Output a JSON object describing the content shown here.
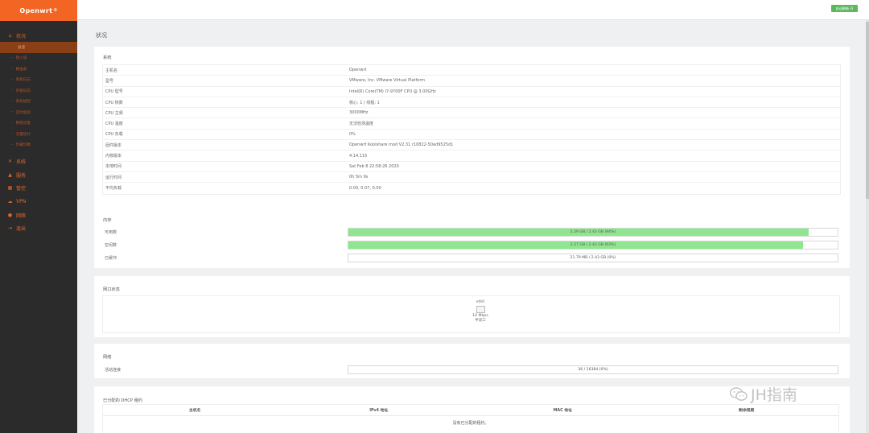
{
  "brand": {
    "name": "Openwrt",
    "mark": "®"
  },
  "sidebar": {
    "status": {
      "icon": "home-icon",
      "label": "状况"
    },
    "sub_items": [
      "总览",
      "防火墙",
      "路由表",
      "系统日志",
      "内核日志",
      "系统进程",
      "实时监控",
      "网络流量",
      "流量统计",
      "负载均衡"
    ],
    "menus": [
      {
        "icon": "wrench-icon",
        "label": "系统"
      },
      {
        "icon": "triangle-icon",
        "label": "服务"
      },
      {
        "icon": "grid-icon",
        "label": "管控"
      },
      {
        "icon": "cloud-icon",
        "label": "VPN"
      },
      {
        "icon": "globe-icon",
        "label": "网络"
      },
      {
        "icon": "logout-icon",
        "label": "退出"
      }
    ]
  },
  "header": {
    "refresh_button": "自动刷新 开"
  },
  "page_title": "状况",
  "system": {
    "title": "系统",
    "rows": [
      {
        "key": "主机名",
        "value": "Openwrt"
      },
      {
        "key": "型号",
        "value": "VMware, Inc. VMware Virtual Platform"
      },
      {
        "key": "CPU 型号",
        "value": "Intel(R) Core(TM) i7-9700F CPU @ 3.00GHz"
      },
      {
        "key": "CPU 核数",
        "value": "核心: 1 / 线程: 1"
      },
      {
        "key": "CPU 主频",
        "value": "3000MHz"
      },
      {
        "key": "CPU 温度",
        "value": "无法检测温度"
      },
      {
        "key": "CPU 负载",
        "value": "0%"
      },
      {
        "key": "固件版本",
        "value": "Openwrt Koolshare mod V2.31 r10822-50ad9525d1"
      },
      {
        "key": "内核版本",
        "value": "4.14.115"
      },
      {
        "key": "本地时间",
        "value": "Sat Feb 8 22:58:26 2020"
      },
      {
        "key": "运行时间",
        "value": "0h 5m 9s"
      },
      {
        "key": "平均负载",
        "value": "0.00, 0.07, 0.00"
      }
    ]
  },
  "memory": {
    "title": "内存",
    "bars": [
      {
        "key": "可用数",
        "text": "2.29 GB / 2.43 GB (94%)",
        "percent": 94
      },
      {
        "key": "空闲数",
        "text": "2.27 GB / 2.43 GB (93%)",
        "percent": 93
      },
      {
        "key": "已缓冲",
        "text": "21.79 MB / 2.43 GB (0%)",
        "percent": 0
      }
    ]
  },
  "ports": {
    "title": "网口状态",
    "iface": {
      "name": "eth0",
      "speed": "10 Mbps",
      "duplex": "半双工",
      "icon": "ethernet-port-icon"
    }
  },
  "network": {
    "title": "网络",
    "conn": {
      "key": "活动连接",
      "text": "36 / 16384 (0%)",
      "percent": 0
    }
  },
  "dhcp": {
    "title": "已分配的 DHCP 租约",
    "cols": [
      "主机名",
      "IPv4 地址",
      "MAC 地址",
      "剩余租期"
    ],
    "empty": "没有已分配的租约。"
  },
  "watermark": {
    "text": "JH指南",
    "icon": "wechat-icon"
  },
  "colors": {
    "brand": "#f26522",
    "sidebar_bg": "#2b2b2b",
    "bar_fill": "#8ee68e",
    "button": "#5cb85c"
  }
}
